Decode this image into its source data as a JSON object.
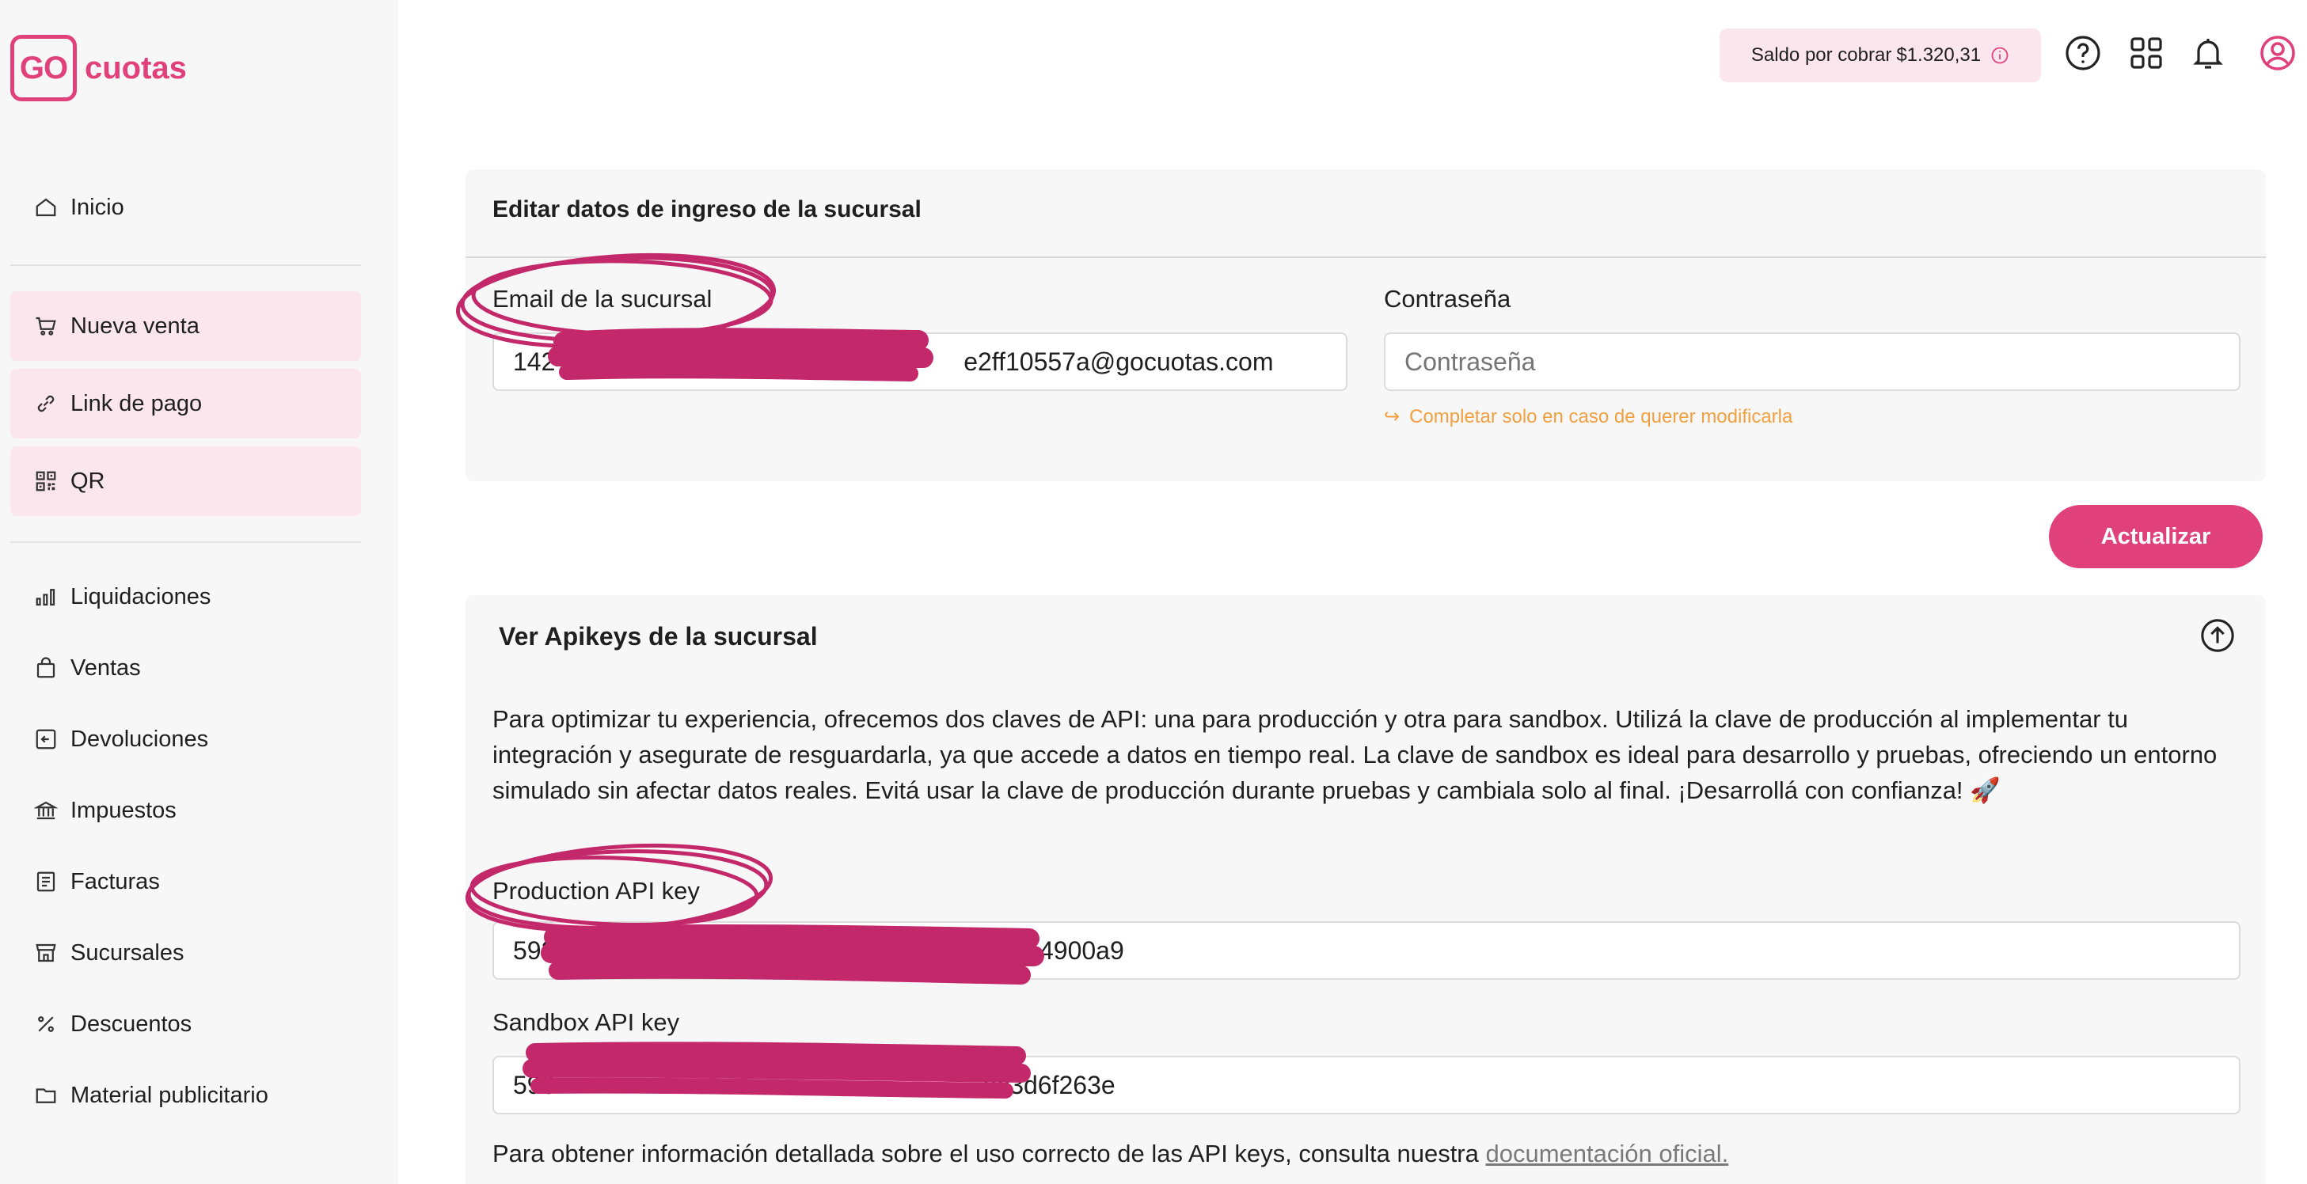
{
  "brand": {
    "logo_box": "GO",
    "logo_text": "cuotas",
    "accent": "#e0417b"
  },
  "sidebar": {
    "items": [
      {
        "label": "Inicio",
        "icon": "home-icon"
      },
      {
        "label": "Nueva venta",
        "icon": "cart-icon"
      },
      {
        "label": "Link de pago",
        "icon": "link-icon"
      },
      {
        "label": "QR",
        "icon": "qr-icon"
      },
      {
        "label": "Liquidaciones",
        "icon": "bar-chart-icon"
      },
      {
        "label": "Ventas",
        "icon": "bag-icon"
      },
      {
        "label": "Devoluciones",
        "icon": "return-icon"
      },
      {
        "label": "Impuestos",
        "icon": "bank-icon"
      },
      {
        "label": "Facturas",
        "icon": "invoice-icon"
      },
      {
        "label": "Sucursales",
        "icon": "store-icon"
      },
      {
        "label": "Descuentos",
        "icon": "percent-icon"
      },
      {
        "label": "Material publicitario",
        "icon": "folder-icon"
      }
    ]
  },
  "topbar": {
    "balance_label": "Saldo por cobrar",
    "balance_amount": "$1.320,31"
  },
  "login_card": {
    "title": "Editar datos de ingreso de la sucursal",
    "email_label": "Email de la sucursal",
    "email_value_start": "1424",
    "email_value_end": "e2ff10557a@gocuotas.com",
    "password_label": "Contraseña",
    "password_placeholder": "Contraseña",
    "password_hint": "Completar solo en caso de querer modificarla",
    "update_button": "Actualizar"
  },
  "apikeys_card": {
    "title": "Ver Apikeys de la sucursal",
    "description": "Para optimizar tu experiencia, ofrecemos dos claves de API: una para producción y otra para sandbox. Utilizá la clave de producción al implementar tu integración y asegurate de resguardarla, ya que accede a datos en tiempo real. La clave de sandbox es ideal para desarrollo y pruebas, ofreciendo un entorno simulado sin afectar datos reales. Evitá usar la clave de producción durante pruebas y cambiala solo al final. ¡Desarrollá con confianza! 🚀",
    "production_label": "Production API key",
    "production_value_start": "593",
    "production_value_end": "a2c4900a9",
    "sandbox_label": "Sandbox API key",
    "sandbox_value_start": "593",
    "sandbox_value_end": "8c3d6f263e",
    "footer_text": "Para obtener información detallada sobre el uso correcto de las API keys, consulta nuestra",
    "footer_link": "documentación oficial."
  }
}
